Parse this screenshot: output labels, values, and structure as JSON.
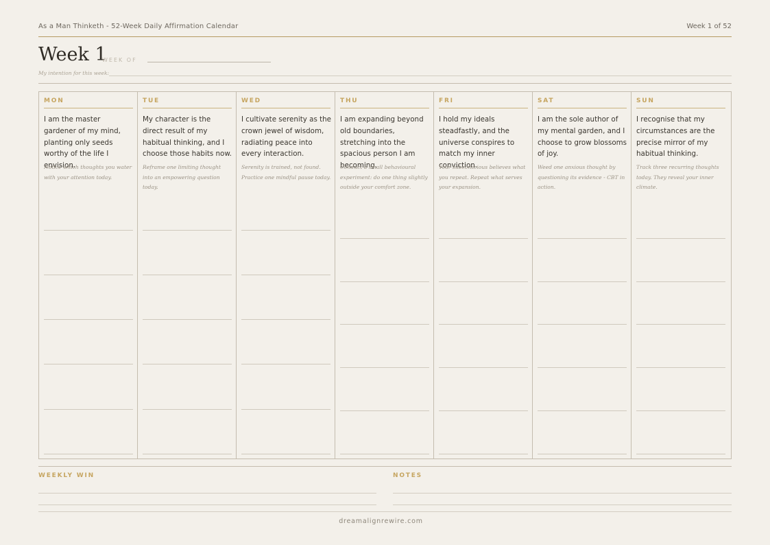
{
  "header": {
    "doc_title": "As a Man Thinketh - 52-Week Daily Affirmation Calendar",
    "week_counter": "Week 1 of 52",
    "week_title": "Week 1",
    "week_of_label": "WEEK OF",
    "intention_label": "My intention for this week:"
  },
  "days": [
    {
      "name": "MON",
      "affirmation": "I am the master gardener of my mind, planting only seeds worthy of the life I envision.",
      "prompt": "Notice which thoughts you water with your attention today."
    },
    {
      "name": "TUE",
      "affirmation": "My character is the direct result of my habitual thinking, and I choose those habits now.",
      "prompt": "Reframe one limiting thought into an empowering question today."
    },
    {
      "name": "WED",
      "affirmation": "I cultivate serenity as the crown jewel of wisdom, radiating peace into every interaction.",
      "prompt": "Serenity is trained, not found. Practice one mindful pause today."
    },
    {
      "name": "THU",
      "affirmation": "I am expanding beyond old boundaries, stretching into the spacious person I am becoming.",
      "prompt": "Conduct a small behavioural experiment: do one thing slightly outside your comfort zone."
    },
    {
      "name": "FRI",
      "affirmation": "I hold my ideals steadfastly, and the universe conspires to match my inner conviction.",
      "prompt": "Your subconscious believes what you repeat. Repeat what serves your expansion."
    },
    {
      "name": "SAT",
      "affirmation": "I am the sole author of my mental garden, and I choose to grow blossoms of joy.",
      "prompt": "Weed one anxious thought by questioning its evidence - CBT in action."
    },
    {
      "name": "SUN",
      "affirmation": "I recognise that my circumstances are the precise mirror of my habitual thinking.",
      "prompt": "Track three recurring thoughts today. They reveal your inner climate."
    }
  ],
  "bottom": {
    "weekly_win_label": "WEEKLY WIN",
    "notes_label": "NOTES"
  },
  "footer": "dreamalignrewire.com",
  "colors": {
    "background": "#f3f0ea",
    "accent_gold": "#c6a560",
    "rule": "#c4bcae"
  }
}
